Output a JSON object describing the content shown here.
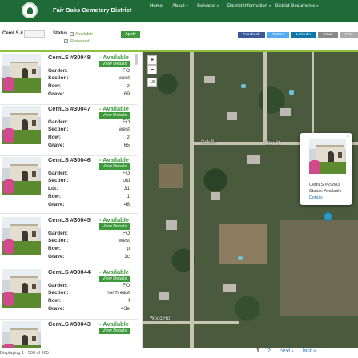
{
  "header": {
    "site_title": "Fair Oaks Cemetery District",
    "nav": [
      "Home",
      "About",
      "Services",
      "District Information",
      "District Documents"
    ],
    "nav_caret": "▾"
  },
  "filters": {
    "cemls_label": "CemLS #",
    "cemls_value": "",
    "status_label": "Status",
    "status_options": [
      "Available",
      "Reserved"
    ],
    "apply_label": "Apply"
  },
  "share": [
    "Facebook",
    "Twitter",
    "LinkedIn",
    "Email",
    "Print"
  ],
  "field_labels": {
    "garden": "Garden:",
    "section": "Section:",
    "lot": "Lot:",
    "row": "Row:",
    "grave": "Grave:"
  },
  "items": [
    {
      "title": "CemLS #30048",
      "status": "- Available",
      "details": "View Details",
      "garden": "FO",
      "section": "west",
      "row": "z",
      "grave": "69"
    },
    {
      "title": "CemLS #30047",
      "status": "- Available",
      "details": "View Details",
      "garden": "FO",
      "section": "west",
      "row": "z",
      "grave": "65"
    },
    {
      "title": "CemLS #30046",
      "status": "- Available",
      "details": "View Details",
      "garden": "FO",
      "section": "old",
      "lot": "31",
      "row": "1",
      "grave": "46"
    },
    {
      "title": "CemLS #30045",
      "status": "- Available",
      "details": "View Details",
      "garden": "FO",
      "section": "west",
      "row": "p",
      "grave": "1c"
    },
    {
      "title": "CemLS #30044",
      "status": "- Available",
      "details": "View Details",
      "garden": "FO",
      "section": "north east",
      "row": "f",
      "grave": "43e"
    },
    {
      "title": "CemLS #30043",
      "status": "- Available",
      "details": "View Details"
    }
  ],
  "map": {
    "zoom_in": "+",
    "zoom_out": "−",
    "zoom_level": "18",
    "road_labels": [
      "Oak St",
      "Oak St",
      "Wood Rd"
    ],
    "popup": {
      "close": "×",
      "title": "CemLS #29883",
      "status": "Status: Available",
      "link": "Details"
    }
  },
  "footer": {
    "summary": "Displaying 1 - 500 of 965",
    "pages": [
      "1",
      "2",
      "next ›",
      "last »"
    ]
  }
}
